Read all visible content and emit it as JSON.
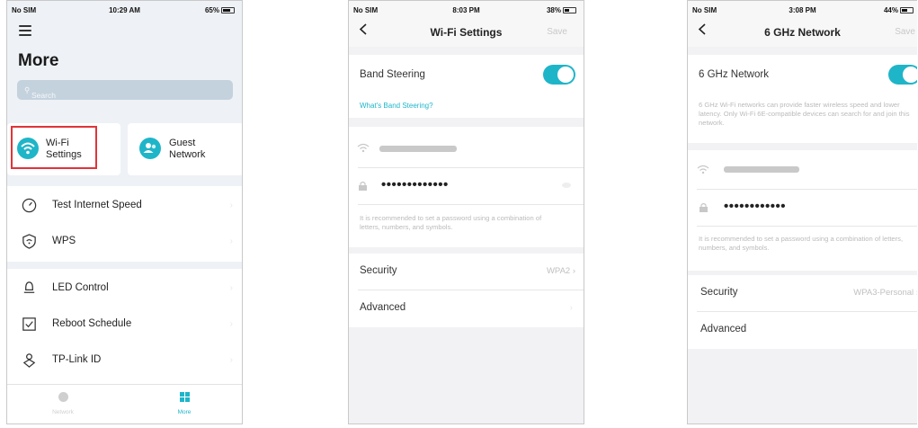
{
  "more_screen": {
    "status": {
      "carrier": "No SIM",
      "time": "10:29 AM",
      "battery": "65%",
      "battery_level": 0.65
    },
    "title": "More",
    "search_placeholder": "Search",
    "tiles": [
      {
        "label_line1": "Wi-Fi",
        "label_line2": "Settings",
        "icon": "wifi-icon",
        "highlighted": true
      },
      {
        "label_line1": "Guest",
        "label_line2": "Network",
        "icon": "guest-users-icon"
      }
    ],
    "list_items": [
      {
        "label": "Test Internet Speed",
        "icon": "speedometer-icon"
      },
      {
        "label": "WPS",
        "icon": "wps-shield-icon"
      },
      {
        "label": "LED Control",
        "icon": "led-lamp-icon"
      },
      {
        "label": "Reboot Schedule",
        "icon": "reboot-calendar-icon"
      },
      {
        "label": "TP-Link ID",
        "icon": "tplink-id-icon"
      }
    ],
    "tabbar": {
      "tab1_label": "Network",
      "tab2_label": "More",
      "accent": "#1fb5c9"
    }
  },
  "wifi_settings_screen": {
    "status": {
      "carrier": "No SIM",
      "time": "8:03 PM",
      "battery": "38%",
      "battery_level": 0.38
    },
    "title": "Wi-Fi Settings",
    "save_label": "Save",
    "band_steering_label": "Band Steering",
    "band_steering_on": true,
    "band_steering_link": "What's Band Steering?",
    "password_masked": "•••••••••••••",
    "password_hint": "It is recommended to set a password using a combination of letters, numbers, and symbols.",
    "security_label": "Security",
    "security_value": "WPA2",
    "advanced_label": "Advanced"
  },
  "ghz6_screen": {
    "status": {
      "carrier": "No SIM",
      "time": "3:08 PM",
      "battery": "44%",
      "battery_level": 0.44
    },
    "title": "6 GHz Network",
    "save_label": "Save",
    "toggle_label": "6 GHz Network",
    "toggle_on": true,
    "description": "6 GHz Wi-Fi networks can provide faster wireless speed and lower latency. Only Wi-Fi 6E-compatible devices can search for and join this network.",
    "password_masked": "••••••••••••",
    "password_hint": "It is recommended to set a password using a combination of letters, numbers, and symbols.",
    "security_label": "Security",
    "security_value": "WPA3-Personal",
    "advanced_label": "Advanced"
  },
  "colors": {
    "accent": "#1fb5c9",
    "highlight_border": "#e0343a"
  }
}
